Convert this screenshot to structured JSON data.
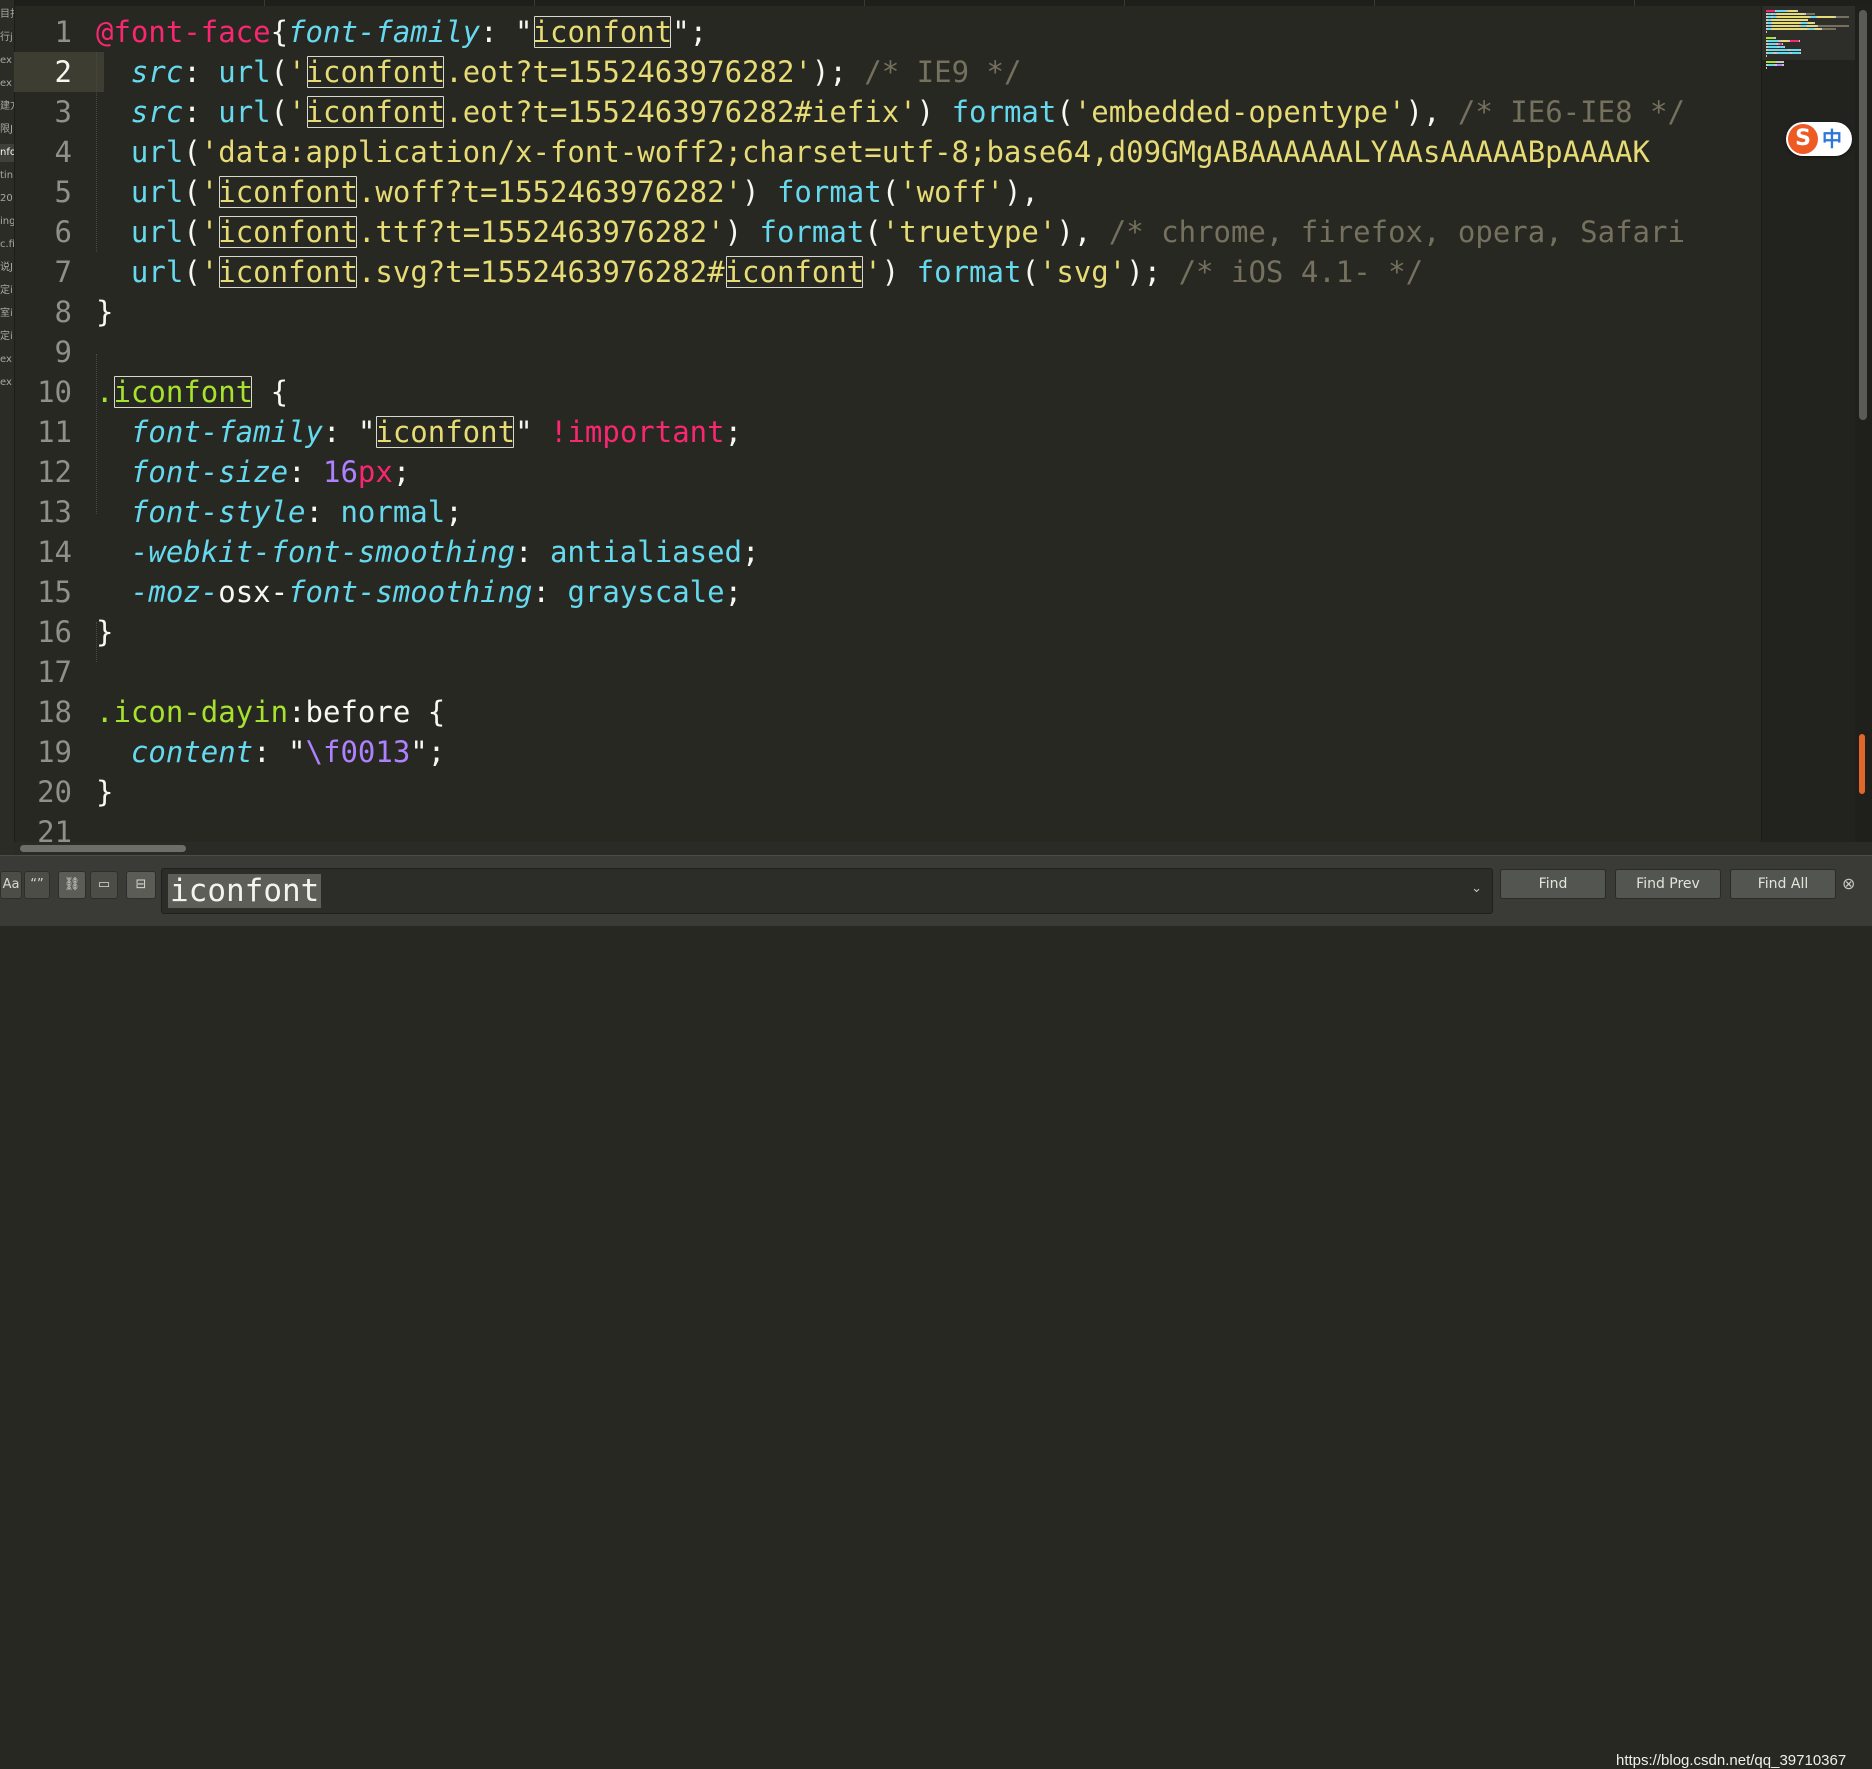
{
  "sidebar": {
    "items": [
      "目打",
      "行j",
      "ex",
      "ex",
      "建方",
      "限J",
      "nfo",
      "tin",
      "20",
      "ing",
      "c.fi",
      "说J",
      "定i",
      "室i",
      "定i",
      "ex",
      "ex"
    ],
    "active_index": 6
  },
  "editor": {
    "current_line": 2,
    "lines": [
      {
        "n": "1",
        "tokens": [
          [
            "k",
            "@font-face"
          ],
          [
            "",
            "{"
          ],
          [
            "p",
            "font-family"
          ],
          [
            "",
            ": \""
          ],
          [
            "s m",
            "iconfont"
          ],
          [
            "",
            "\";"
          ]
        ]
      },
      {
        "n": "2",
        "tokens": [
          [
            "",
            "  "
          ],
          [
            "p",
            "src"
          ],
          [
            "",
            ": "
          ],
          [
            "fn",
            "url"
          ],
          [
            "",
            "("
          ],
          [
            "s",
            "'"
          ],
          [
            "s m",
            "iconfont"
          ],
          [
            "s",
            ".eot?t=1552463976282'"
          ],
          [
            "",
            ");"
          ],
          [
            "c",
            " /* IE9 */"
          ]
        ]
      },
      {
        "n": "3",
        "tokens": [
          [
            "",
            "  "
          ],
          [
            "p",
            "src"
          ],
          [
            "",
            ": "
          ],
          [
            "fn",
            "url"
          ],
          [
            "",
            "("
          ],
          [
            "s",
            "'"
          ],
          [
            "s m",
            "iconfont"
          ],
          [
            "s",
            ".eot?t=1552463976282#iefix'"
          ],
          [
            "",
            ") "
          ],
          [
            "fn",
            "format"
          ],
          [
            "",
            "("
          ],
          [
            "s",
            "'embedded-opentype'"
          ],
          [
            "",
            "),"
          ],
          [
            "c",
            " /* IE6-IE8 */"
          ]
        ]
      },
      {
        "n": "4",
        "tokens": [
          [
            "",
            "  "
          ],
          [
            "fn",
            "url"
          ],
          [
            "",
            "("
          ],
          [
            "s",
            "'data:application/x-font-woff2;charset=utf-8;base64,d09GMgABAAAAAALYAAsAAAAABpAAAAK"
          ]
        ]
      },
      {
        "n": "5",
        "tokens": [
          [
            "",
            "  "
          ],
          [
            "fn",
            "url"
          ],
          [
            "",
            "("
          ],
          [
            "s",
            "'"
          ],
          [
            "s m",
            "iconfont"
          ],
          [
            "s",
            ".woff?t=1552463976282'"
          ],
          [
            "",
            ") "
          ],
          [
            "fn",
            "format"
          ],
          [
            "",
            "("
          ],
          [
            "s",
            "'woff'"
          ],
          [
            "",
            "),"
          ]
        ]
      },
      {
        "n": "6",
        "tokens": [
          [
            "",
            "  "
          ],
          [
            "fn",
            "url"
          ],
          [
            "",
            "("
          ],
          [
            "s",
            "'"
          ],
          [
            "s m",
            "iconfont"
          ],
          [
            "s",
            ".ttf?t=1552463976282'"
          ],
          [
            "",
            ") "
          ],
          [
            "fn",
            "format"
          ],
          [
            "",
            "("
          ],
          [
            "s",
            "'truetype'"
          ],
          [
            "",
            "),"
          ],
          [
            "c",
            " /* chrome, firefox, opera, Safari"
          ]
        ]
      },
      {
        "n": "7",
        "tokens": [
          [
            "",
            "  "
          ],
          [
            "fn",
            "url"
          ],
          [
            "",
            "("
          ],
          [
            "s",
            "'"
          ],
          [
            "s m",
            "iconfont"
          ],
          [
            "s",
            ".svg?t=1552463976282#"
          ],
          [
            "s m",
            "iconfont"
          ],
          [
            "s",
            "'"
          ],
          [
            "",
            ") "
          ],
          [
            "fn",
            "format"
          ],
          [
            "",
            "("
          ],
          [
            "s",
            "'svg'"
          ],
          [
            "",
            ");"
          ],
          [
            "c",
            " /* iOS 4.1- */"
          ]
        ]
      },
      {
        "n": "8",
        "tokens": [
          [
            "",
            "}"
          ]
        ]
      },
      {
        "n": "9",
        "tokens": []
      },
      {
        "n": "10",
        "tokens": [
          [
            "sel",
            "."
          ],
          [
            "sel m",
            "iconfont"
          ],
          [
            "",
            " {"
          ]
        ]
      },
      {
        "n": "11",
        "tokens": [
          [
            "",
            "  "
          ],
          [
            "p",
            "font-family"
          ],
          [
            "",
            ": \""
          ],
          [
            "s m",
            "iconfont"
          ],
          [
            "",
            "\" "
          ],
          [
            "k",
            "!important"
          ],
          [
            "",
            ";"
          ]
        ]
      },
      {
        "n": "12",
        "tokens": [
          [
            "",
            "  "
          ],
          [
            "p",
            "font-size"
          ],
          [
            "",
            ": "
          ],
          [
            "n",
            "16"
          ],
          [
            "k",
            "px"
          ],
          [
            "",
            ";"
          ]
        ]
      },
      {
        "n": "13",
        "tokens": [
          [
            "",
            "  "
          ],
          [
            "p",
            "font-style"
          ],
          [
            "",
            ": "
          ],
          [
            "fn",
            "normal"
          ],
          [
            "",
            ";"
          ]
        ]
      },
      {
        "n": "14",
        "tokens": [
          [
            "",
            "  "
          ],
          [
            "p",
            "-webkit-font-smoothing"
          ],
          [
            "",
            ": "
          ],
          [
            "fn",
            "antialiased"
          ],
          [
            "",
            ";"
          ]
        ]
      },
      {
        "n": "15",
        "tokens": [
          [
            "",
            "  "
          ],
          [
            "p",
            "-moz-"
          ],
          [
            "",
            "osx-"
          ],
          [
            "p",
            "font-smoothing"
          ],
          [
            "",
            ": "
          ],
          [
            "fn",
            "grayscale"
          ],
          [
            "",
            ";"
          ]
        ]
      },
      {
        "n": "16",
        "tokens": [
          [
            "",
            "}"
          ]
        ]
      },
      {
        "n": "17",
        "tokens": []
      },
      {
        "n": "18",
        "tokens": [
          [
            "sel",
            ".icon-dayin"
          ],
          [
            "",
            ":before {"
          ]
        ]
      },
      {
        "n": "19",
        "tokens": [
          [
            "",
            "  "
          ],
          [
            "p",
            "content"
          ],
          [
            "",
            ": \""
          ],
          [
            "n",
            "\\f0013"
          ],
          [
            "",
            "\";"
          ]
        ]
      },
      {
        "n": "20",
        "tokens": [
          [
            "",
            "}"
          ]
        ]
      },
      {
        "n": "21",
        "tokens": []
      }
    ]
  },
  "ime": {
    "logo": "S",
    "mode": "中"
  },
  "find_panel": {
    "toggles": [
      {
        "name": "case-sensitive-toggle",
        "label": "Aa",
        "on": false
      },
      {
        "name": "whole-word-toggle",
        "label": "“”",
        "on": false
      },
      {
        "name": "wrap-toggle",
        "label": "⛓",
        "on": true
      },
      {
        "name": "in-selection-toggle",
        "label": "▭",
        "on": false
      },
      {
        "name": "highlight-matches-toggle",
        "label": "⊟",
        "on": true
      }
    ],
    "query": "iconfont",
    "buttons": {
      "find": "Find",
      "find_prev": "Find Prev",
      "find_all": "Find All"
    },
    "close": "⊗"
  },
  "watermark": "https://blog.csdn.net/qq_39710367",
  "colors": {
    "background": "#272822",
    "keyword": "#f92672",
    "property": "#66d9ef",
    "string": "#e6db74",
    "comment": "#75715e",
    "number": "#ae81ff",
    "selector": "#a6e22e"
  }
}
